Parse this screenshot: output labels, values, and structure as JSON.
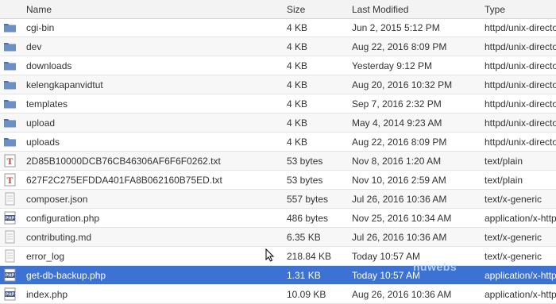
{
  "header": {
    "name": "Name",
    "size": "Size",
    "last_modified": "Last Modified",
    "type": "Type"
  },
  "files": [
    {
      "name": "cgi-bin",
      "size": "4 KB",
      "modified": "Jun 2, 2015 5:12 PM",
      "type": "httpd/unix-directory",
      "icon": "folder-icon"
    },
    {
      "name": "dev",
      "size": "4 KB",
      "modified": "Aug 22, 2016 8:09 PM",
      "type": "httpd/unix-directory",
      "icon": "folder-icon"
    },
    {
      "name": "downloads",
      "size": "4 KB",
      "modified": "Yesterday 9:12 PM",
      "type": "httpd/unix-directory",
      "icon": "folder-icon"
    },
    {
      "name": "kelengkapanvidtut",
      "size": "4 KB",
      "modified": "Aug 20, 2016 10:32 PM",
      "type": "httpd/unix-directory",
      "icon": "folder-icon"
    },
    {
      "name": "templates",
      "size": "4 KB",
      "modified": "Sep 7, 2016 2:32 PM",
      "type": "httpd/unix-directory",
      "icon": "folder-icon"
    },
    {
      "name": "upload",
      "size": "4 KB",
      "modified": "May 4, 2014 9:23 AM",
      "type": "httpd/unix-directory",
      "icon": "folder-icon"
    },
    {
      "name": "uploads",
      "size": "4 KB",
      "modified": "Aug 22, 2016 8:09 PM",
      "type": "httpd/unix-directory",
      "icon": "folder-icon"
    },
    {
      "name": "2D85B10000DCB76CB46306AF6F6F0262.txt",
      "size": "53 bytes",
      "modified": "Nov 8, 2016 1:20 AM",
      "type": "text/plain",
      "icon": "text-file-icon"
    },
    {
      "name": "627F2C275EFDDA401FA8B062160B75ED.txt",
      "size": "53 bytes",
      "modified": "Nov 10, 2016 2:59 AM",
      "type": "text/plain",
      "icon": "text-file-icon"
    },
    {
      "name": "composer.json",
      "size": "557 bytes",
      "modified": "Jul 26, 2016 10:36 AM",
      "type": "text/x-generic",
      "icon": "generic-file-icon"
    },
    {
      "name": "configuration.php",
      "size": "486 bytes",
      "modified": "Nov 25, 2016 10:34 AM",
      "type": "application/x-httpd-php",
      "icon": "php-file-icon"
    },
    {
      "name": "contributing.md",
      "size": "6.35 KB",
      "modified": "Jul 26, 2016 10:36 AM",
      "type": "text/x-generic",
      "icon": "generic-file-icon"
    },
    {
      "name": "error_log",
      "size": "218.84 KB",
      "modified": "Today 10:57 AM",
      "type": "text/x-generic",
      "icon": "generic-file-icon"
    },
    {
      "name": "get-db-backup.php",
      "size": "1.31 KB",
      "modified": "Today 10:57 AM",
      "type": "application/x-httpd-php",
      "icon": "php-file-icon",
      "selected": true
    },
    {
      "name": "index.php",
      "size": "10.09 KB",
      "modified": "Aug 26, 2016 10:36 AM",
      "type": "application/x-httpd-php",
      "icon": "php-file-icon"
    }
  ],
  "watermark": "nuwebs",
  "colors": {
    "selected_row": "#3b72d4",
    "folder": "#5b7fb8",
    "header_bg": "#f3f3f3"
  }
}
